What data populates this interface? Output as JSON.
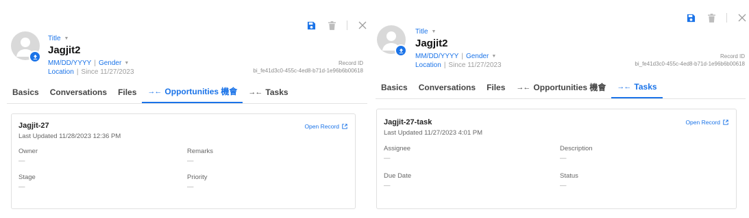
{
  "colors": {
    "accent": "#1a73e8",
    "text": "#222222",
    "muted": "#9e9e9e",
    "border": "#e0e0e0"
  },
  "left": {
    "header": {
      "title_label": "Title",
      "name": "Jagjit2",
      "dob": "MM/DD/YYYY",
      "gender": "Gender",
      "location": "Location",
      "since": "Since 11/27/2023",
      "record_id_label": "Record ID",
      "record_id": "bi_fe41d3c0-455c-4ed8-b71d-1e96b6b00618",
      "actions": [
        "save-icon",
        "trash-icon",
        "close-icon"
      ]
    },
    "tabs": [
      {
        "label": "Basics",
        "icon": ""
      },
      {
        "label": "Conversations",
        "icon": ""
      },
      {
        "label": "Files",
        "icon": ""
      },
      {
        "label": "Opportunities 機會",
        "icon": "merge-arrows-icon"
      },
      {
        "label": "Tasks",
        "icon": "merge-arrows-icon"
      }
    ],
    "active_tab": "Opportunities 機會",
    "card": {
      "title": "Jagjit-27",
      "updated": "Last Updated 11/28/2023 12:36 PM",
      "open_record": "Open Record",
      "fields": [
        {
          "label": "Owner",
          "value": "—"
        },
        {
          "label": "Remarks",
          "value": "—"
        },
        {
          "label": "Stage",
          "value": "—"
        },
        {
          "label": "Priority",
          "value": "—"
        }
      ]
    }
  },
  "right": {
    "header": {
      "title_label": "Title",
      "name": "Jagjit2",
      "dob": "MM/DD/YYYY",
      "gender": "Gender",
      "location": "Location",
      "since": "Since 11/27/2023",
      "record_id_label": "Record ID",
      "record_id": "bi_fe41d3c0-455c-4ed8-b71d-1e96b6b00618",
      "actions": [
        "save-icon",
        "trash-icon",
        "close-icon"
      ]
    },
    "tabs": [
      {
        "label": "Basics",
        "icon": ""
      },
      {
        "label": "Conversations",
        "icon": ""
      },
      {
        "label": "Files",
        "icon": ""
      },
      {
        "label": "Opportunities 機會",
        "icon": "merge-arrows-icon"
      },
      {
        "label": "Tasks",
        "icon": "merge-arrows-icon"
      }
    ],
    "active_tab": "Tasks",
    "card": {
      "title": "Jagjit-27-task",
      "updated": "Last Updated 11/27/2023 4:01 PM",
      "open_record": "Open Record",
      "fields": [
        {
          "label": "Assignee",
          "value": "—"
        },
        {
          "label": "Description",
          "value": "—"
        },
        {
          "label": "Due Date",
          "value": "—"
        },
        {
          "label": "Status",
          "value": "—"
        }
      ]
    }
  }
}
